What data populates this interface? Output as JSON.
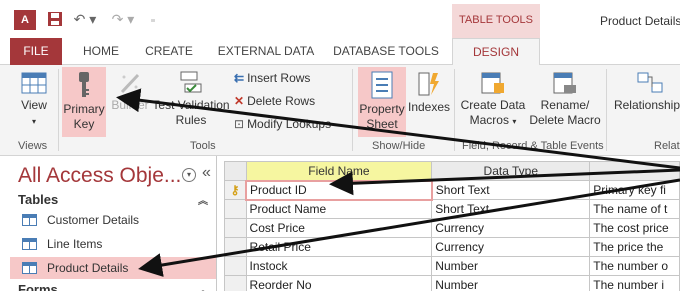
{
  "titlebar": {
    "app_icon_text": "A",
    "context_tab_header": "TABLE TOOLS",
    "window_title": "Product Details"
  },
  "tabs": {
    "file": "FILE",
    "home": "HOME",
    "create": "CREATE",
    "external_data": "EXTERNAL DATA",
    "database_tools": "DATABASE TOOLS",
    "design": "DESIGN"
  },
  "ribbon": {
    "view_label": "View",
    "primary_key_line1": "Primary",
    "primary_key_line2": "Key",
    "builder_label": "Builder",
    "test_validation_line1": "Test Validation",
    "test_validation_line2": "Rules",
    "insert_rows": "Insert Rows",
    "delete_rows": "Delete Rows",
    "modify_lookups": "Modify Lookups",
    "property_sheet_line1": "Property",
    "property_sheet_line2": "Sheet",
    "indexes_label": "Indexes",
    "create_data_macros_line1": "Create Data",
    "create_data_macros_line2": "Macros",
    "rename_delete_macro_line1": "Rename/",
    "rename_delete_macro_line2": "Delete Macro",
    "relationships_label": "Relationships",
    "group_views": "Views",
    "group_tools": "Tools",
    "group_show_hide": "Show/Hide",
    "group_field_record": "Field, Record & Table Events",
    "group_relationships": "Relat"
  },
  "navpane": {
    "title": "All Access Obje...",
    "tables_header": "Tables",
    "items": [
      "Customer Details",
      "Line Items",
      "Product Details"
    ],
    "forms_header": "Forms"
  },
  "grid": {
    "headers": [
      "Field Name",
      "Data Type",
      ""
    ],
    "rows": [
      {
        "field": "Product ID",
        "type": "Short Text",
        "desc": "Primary key fi"
      },
      {
        "field": "Product Name",
        "type": "Short Text",
        "desc": "The name of t"
      },
      {
        "field": "Cost Price",
        "type": "Currency",
        "desc": "The cost price"
      },
      {
        "field": "Retail Price",
        "type": "Currency",
        "desc": "The price the"
      },
      {
        "field": "Instock",
        "type": "Number",
        "desc": "The number o"
      },
      {
        "field": "Reorder No",
        "type": "Number",
        "desc": "The number i"
      }
    ]
  },
  "colors": {
    "accent": "#a4373a",
    "highlight": "#f6c8c8",
    "ribbon_bg": "#f4f4f4"
  }
}
